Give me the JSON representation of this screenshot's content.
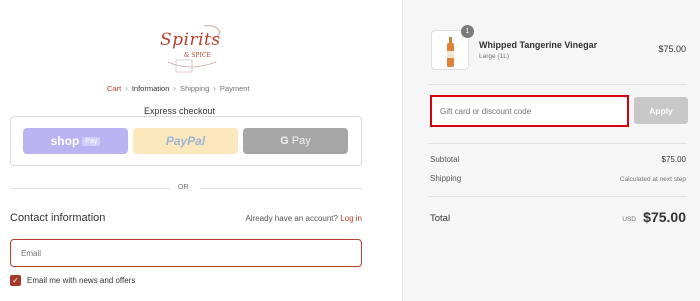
{
  "brand": {
    "logo_main": "Spirits",
    "logo_sub": "& SPICE"
  },
  "breadcrumb": {
    "cart": "Cart",
    "information": "Information",
    "shipping": "Shipping",
    "payment": "Payment"
  },
  "express": {
    "title": "Express checkout",
    "shop_pay": "shop",
    "shop_pay_badge": "Pay",
    "paypal": "PayPal",
    "gpay_g": "G",
    "gpay": "Pay"
  },
  "divider": {
    "or": "OR"
  },
  "contact": {
    "title": "Contact information",
    "account_prompt": "Already have an account?",
    "login": "Log in",
    "email_placeholder": "Email",
    "newsletter_label": "Email me with news and offers"
  },
  "order": {
    "quantity": "1",
    "product_name": "Whipped Tangerine Vinegar",
    "product_variant": "Large (1L)",
    "product_price": "$75.00",
    "gift_placeholder": "Gift card or discount code",
    "apply_label": "Apply",
    "subtotal_label": "Subtotal",
    "subtotal_value": "$75.00",
    "shipping_label": "Shipping",
    "shipping_value": "Calculated at next step",
    "total_label": "Total",
    "total_currency": "USD",
    "total_value": "$75.00"
  },
  "colors": {
    "accent": "#b5412b",
    "shop_pay": "#b9b3f2",
    "paypal": "#fbe9bd",
    "gpay": "#a6a6a6",
    "highlight": "#d4000d"
  }
}
